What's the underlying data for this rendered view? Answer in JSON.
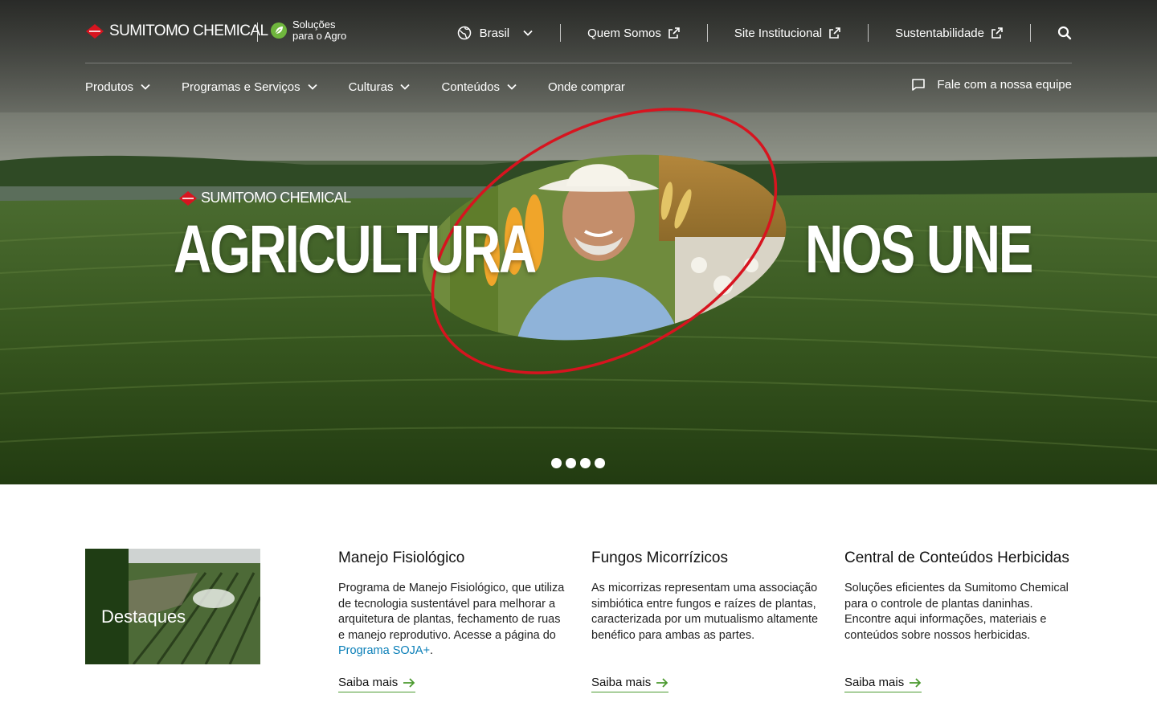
{
  "header": {
    "brand": "SUMITOMO CHEMICAL",
    "tagline_line1": "Soluções",
    "tagline_line2": "para o Agro",
    "region": "Brasil",
    "links": [
      "Quem Somos",
      "Site Institucional",
      "Sustentabilidade"
    ],
    "icons": {
      "region": "globe-icon",
      "external": "external-link-icon",
      "search": "search-icon"
    }
  },
  "nav": {
    "items": [
      "Produtos",
      "Programas e Serviços",
      "Culturas",
      "Conteúdos",
      "Onde comprar"
    ],
    "contact": "Fale com a nossa equipe"
  },
  "hero": {
    "brand": "SUMITOMO CHEMICAL",
    "title_left": "AGRICULTURA",
    "title_right": "NOS UNE",
    "slides": 4,
    "active_slide": 1
  },
  "highlights": {
    "label": "Destaques",
    "cards": [
      {
        "title": "Manejo Fisiológico",
        "text": "Programa de Manejo Fisiológico, que utiliza de tecnologia sustentável para melhorar a arquitetura de plantas, fechamento de ruas e manejo reprodutivo. Acesse a página do",
        "link": "Programa SOJA+",
        "after": ".",
        "cta": "Saiba mais"
      },
      {
        "title": "Fungos Micorrízicos",
        "text": "As micorrizas representam uma associação simbiótica entre fungos e raízes de plantas, caracterizada por um mutualismo altamente benéfico para ambas as partes.",
        "cta": "Saiba mais"
      },
      {
        "title": "Central de Conteúdos Herbicidas",
        "text": "Soluções eficientes da Sumitomo Chemical para o controle de plantas daninhas. Encontre aqui informações, materiais e conteúdos sobre nossos herbicidas.",
        "cta": "Saiba mais"
      }
    ]
  },
  "colors": {
    "brand_red": "#d7141f",
    "accent_green": "#4b9a2f",
    "link_blue": "#0a7fb8",
    "dark_green": "#1f3d14"
  }
}
